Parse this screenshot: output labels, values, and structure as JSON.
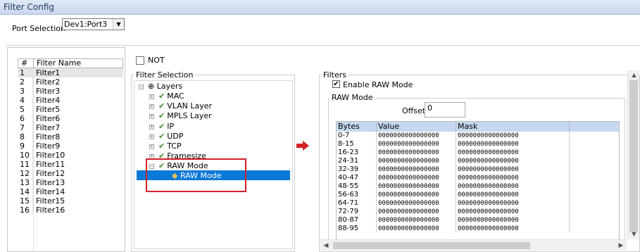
{
  "window": {
    "title": "Filter Config"
  },
  "port_selection": {
    "label": "Port Selection",
    "value": "Dev1:Port3"
  },
  "filter_list": {
    "columns": [
      "#",
      "Filter Name"
    ],
    "rows": [
      {
        "num": "1",
        "name": "Filter1"
      },
      {
        "num": "2",
        "name": "Filter2"
      },
      {
        "num": "3",
        "name": "Filter3"
      },
      {
        "num": "4",
        "name": "Filter4"
      },
      {
        "num": "5",
        "name": "Filter5"
      },
      {
        "num": "6",
        "name": "Filter6"
      },
      {
        "num": "7",
        "name": "Filter7"
      },
      {
        "num": "8",
        "name": "Filter8"
      },
      {
        "num": "9",
        "name": "Filter9"
      },
      {
        "num": "10",
        "name": "Filter10"
      },
      {
        "num": "11",
        "name": "Filter11"
      },
      {
        "num": "12",
        "name": "Filter12"
      },
      {
        "num": "13",
        "name": "Filter13"
      },
      {
        "num": "14",
        "name": "Filter14"
      },
      {
        "num": "15",
        "name": "Filter15"
      },
      {
        "num": "16",
        "name": "Filter16"
      }
    ],
    "selected_index": 0
  },
  "not_checkbox": {
    "label": "NOT",
    "checked": false
  },
  "filter_selection": {
    "title": "Filter Selection",
    "root": "Layers",
    "items": [
      "MAC",
      "VLAN Layer",
      "MPLS Layer",
      "IP",
      "UDP",
      "TCP",
      "Framesize",
      "RAW Mode"
    ],
    "child": "RAW Mode"
  },
  "filters": {
    "title": "Filters",
    "enable_raw_label": "Enable RAW Mode",
    "enable_raw_checked": true,
    "raw_group_title": "RAW Mode",
    "offset_label": "Offset",
    "offset_value": "0",
    "grid_columns": [
      "Bytes",
      "Value",
      "Mask"
    ],
    "grid_rows": [
      {
        "bytes": "0-7",
        "value": "0000000000000000",
        "mask": "0000000000000000"
      },
      {
        "bytes": "8-15",
        "value": "0000000000000000",
        "mask": "0000000000000000"
      },
      {
        "bytes": "16-23",
        "value": "0000000000000000",
        "mask": "0000000000000000"
      },
      {
        "bytes": "24-31",
        "value": "0000000000000000",
        "mask": "0000000000000000"
      },
      {
        "bytes": "32-39",
        "value": "0000000000000000",
        "mask": "0000000000000000"
      },
      {
        "bytes": "40-47",
        "value": "0000000000000000",
        "mask": "0000000000000000"
      },
      {
        "bytes": "48-55",
        "value": "0000000000000000",
        "mask": "0000000000000000"
      },
      {
        "bytes": "56-63",
        "value": "0000000000000000",
        "mask": "0000000000000000"
      },
      {
        "bytes": "64-71",
        "value": "0000000000000000",
        "mask": "0000000000000000"
      },
      {
        "bytes": "72-79",
        "value": "0000000000000000",
        "mask": "0000000000000000"
      },
      {
        "bytes": "80-87",
        "value": "0000000000000000",
        "mask": "0000000000000000"
      },
      {
        "bytes": "88-95",
        "value": "0000000000000000",
        "mask": "0000000000000000"
      }
    ]
  },
  "colors": {
    "selection": "#0a78d7",
    "highlight_box": "#d32128",
    "arrow": "#d32128",
    "check": "#3f8f2a",
    "grid_header": "#c6d8ee"
  }
}
